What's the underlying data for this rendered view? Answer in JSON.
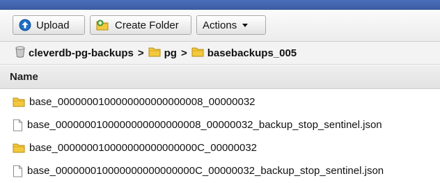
{
  "toolbar": {
    "upload_label": "Upload",
    "create_folder_label": "Create Folder",
    "actions_label": "Actions"
  },
  "breadcrumb": {
    "items": [
      "cleverdb-pg-backups",
      "pg",
      "basebackups_005"
    ],
    "separator": ">"
  },
  "table": {
    "column_header": "Name",
    "rows": [
      {
        "name": "base_0000000100000000000000008_00000032",
        "type": "folder"
      },
      {
        "name": "base_0000000100000000000000008_00000032_backup_stop_sentinel.json",
        "type": "file"
      },
      {
        "name": "base_000000010000000000000000C_00000032",
        "type": "folder"
      },
      {
        "name": "base_000000010000000000000000C_00000032_backup_stop_sentinel.json",
        "type": "file"
      }
    ]
  },
  "icons": {
    "upload": "upload-icon",
    "create_folder": "add-folder-icon",
    "actions_caret": "caret-down-icon",
    "bucket": "bucket-icon",
    "folder": "folder-icon",
    "file": "file-icon"
  },
  "colors": {
    "topbar": "#3f62a9",
    "upload_icon": "#1f6fc8",
    "folder_yellow": "#f3c93c"
  }
}
